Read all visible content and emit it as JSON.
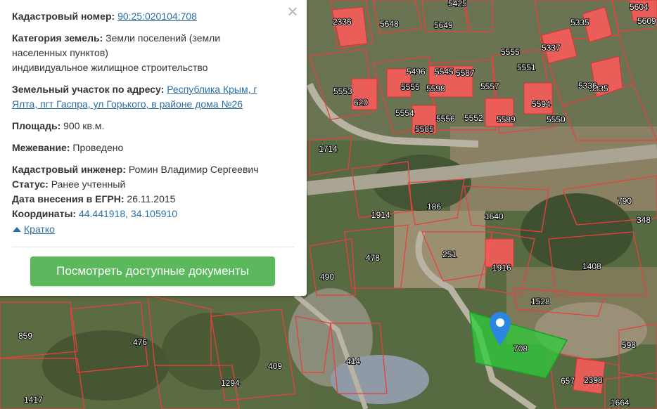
{
  "panel": {
    "cadastral_number_label": "Кадастровый номер:",
    "cadastral_number_value": "90:25:020104:708",
    "land_category_label": "Категория земель:",
    "land_category_value_line1": "Земли поселений (земли",
    "land_category_value_line2": "населенных пунктов)",
    "land_use_value": "индивидуальное жилищное строительство",
    "address_label": "Земельный участок по адресу:",
    "address_value_line1": "Республика Крым, г",
    "address_value_line2": "Ялта, пгт Гаспра, ул Горького, в районе дома №26",
    "area_label": "Площадь:",
    "area_value": "900 кв.м.",
    "survey_label": "Межевание:",
    "survey_value": "Проведено",
    "engineer_label": "Кадастровый инженер:",
    "engineer_value": "Ромин Владимир Сергеевич",
    "status_label": "Статус:",
    "status_value": "Ранее учтенный",
    "egrn_date_label": "Дата внесения в ЕГРН:",
    "egrn_date_value": "26.11.2015",
    "coordinates_label": "Координаты:",
    "coordinates_value": "44.441918, 34.105910",
    "collapse_label": "Кратко",
    "documents_button": "Посмотреть доступные документы",
    "close_icon": "close-icon"
  },
  "map": {
    "selected_parcel": "708",
    "parcel_labels": [
      "2336",
      "5648",
      "5649",
      "5425",
      "5335",
      "5335",
      "5604",
      "5609",
      "5555",
      "5337",
      "5551",
      "5553",
      "5555",
      "5598",
      "5557",
      "5336",
      "5554",
      "5585",
      "5556",
      "5552",
      "5589",
      "5550",
      "5594",
      "1714",
      "1914",
      "186",
      "1640",
      "790",
      "348",
      "251",
      "1916",
      "1408",
      "478",
      "490",
      "1528",
      "859",
      "476",
      "409",
      "414",
      "1294",
      "1417",
      "2398",
      "657",
      "598",
      "1664",
      "5496",
      "5545",
      "5587",
      "620"
    ],
    "colors": {
      "parcel_line": "#e8403f",
      "building_fill": "#ff5a5a",
      "selected_fill": "#2ecc3b",
      "pin": "#2a86e0"
    }
  }
}
